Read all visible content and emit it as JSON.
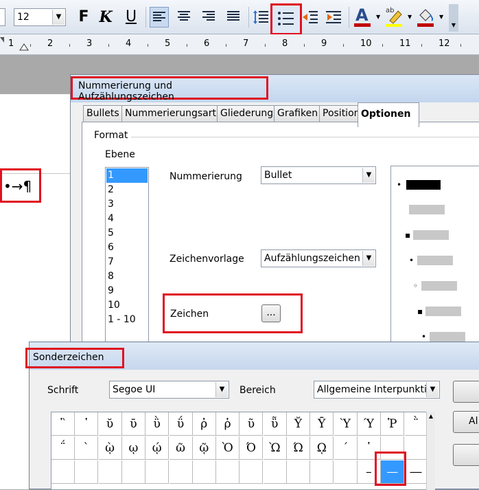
{
  "toolbar": {
    "font_size": "12",
    "bold_glyph": "F",
    "italic_glyph": "K",
    "underline_glyph": "U"
  },
  "ruler": {
    "numbers": [
      "1",
      "2",
      "3",
      "4",
      "5",
      "6",
      "7",
      "8",
      "9",
      "10",
      "11",
      "12"
    ]
  },
  "paragraph": {
    "marks": "•→¶"
  },
  "dialog_numbering": {
    "title": "Nummerierung und Aufzählungszeichen",
    "tabs": [
      "Bullets",
      "Nummerierungsart",
      "Gliederung",
      "Grafiken",
      "Position",
      "Optionen"
    ],
    "format_label": "Format",
    "level_label": "Ebene",
    "levels": [
      "1",
      "2",
      "3",
      "4",
      "5",
      "6",
      "7",
      "8",
      "9",
      "10",
      "1 - 10"
    ],
    "numbering_label": "Nummerierung",
    "numbering_value": "Bullet",
    "char_style_label": "Zeichenvorlage",
    "char_style_value": "Aufzählungszeichen",
    "character_label": "Zeichen",
    "character_button": "...",
    "preview_bullets": [
      "•",
      "▪",
      "•",
      "◦",
      "▪",
      "•"
    ]
  },
  "dialog_special": {
    "title": "Sonderzeichen",
    "font_label": "Schrift",
    "font_value": "Segoe UI",
    "range_label": "Bereich",
    "range_value": "Allgemeine Interpunktio",
    "side_button_2": "Al",
    "grid_row1": [
      "῝",
      "῾",
      "ῠ",
      "ῡ",
      "ῢ",
      "ΰ",
      "ῤ",
      "ῥ",
      "ῦ",
      "ῧ",
      "Ῠ",
      "Ῡ",
      "Ὺ",
      "Ύ",
      "Ῥ",
      "῭"
    ],
    "grid_row2": [
      "΅",
      "`",
      "ῲ",
      "ῳ",
      "ῴ",
      "ῶ",
      "ῷ",
      "Ὸ",
      "Ό",
      "Ὼ",
      "Ώ",
      "ῼ",
      "´",
      "῾",
      "",
      ""
    ],
    "grid_row3": [
      "",
      "",
      "",
      "",
      "",
      "",
      "",
      "",
      "",
      "",
      "",
      "",
      "",
      "–",
      "—",
      "―"
    ]
  }
}
